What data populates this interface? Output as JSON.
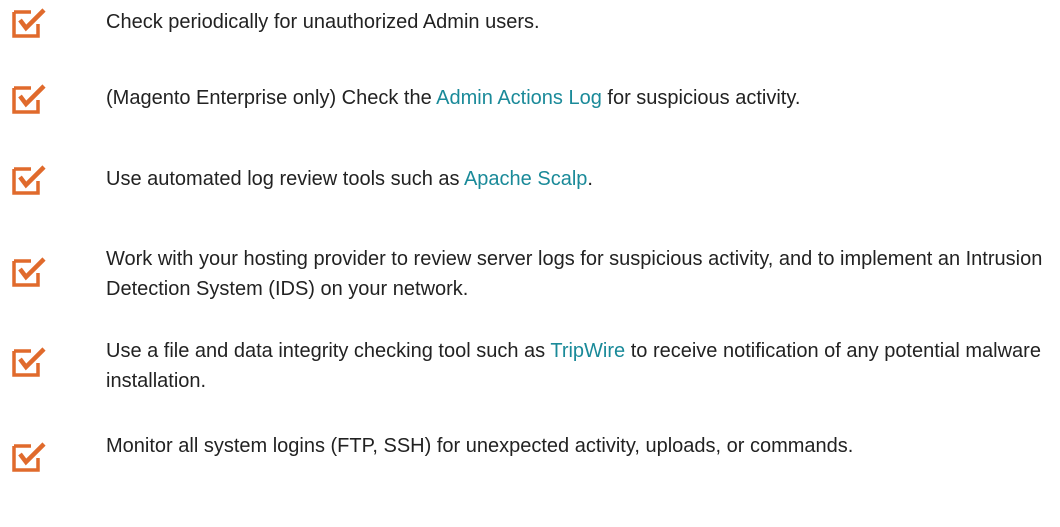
{
  "theme": {
    "icon_color": "#e06a2c",
    "link_color": "#1a8a99",
    "text_color": "#222222"
  },
  "checklist": {
    "icon_name": "checked-box-icon",
    "items": [
      {
        "before": "Check periodically for unauthorized Admin users.",
        "link": "",
        "after": ""
      },
      {
        "before": "(Magento Enterprise only) Check the ",
        "link": "Admin Actions Log",
        "after": " for suspicious activity."
      },
      {
        "before": "Use automated log review tools such as ",
        "link": "Apache Scalp",
        "after": "."
      },
      {
        "before": "Work with your hosting provider to review server logs for suspicious activity, and to implement an Intrusion Detection System (IDS) on your network.",
        "link": "",
        "after": ""
      },
      {
        "before": "Use a file and data integrity checking tool such as ",
        "link": "TripWire",
        "after": " to receive notification of any potential malware installation."
      },
      {
        "before": "Monitor all system logins (FTP, SSH) for unexpected activity, uploads, or commands.",
        "link": "",
        "after": ""
      }
    ]
  }
}
